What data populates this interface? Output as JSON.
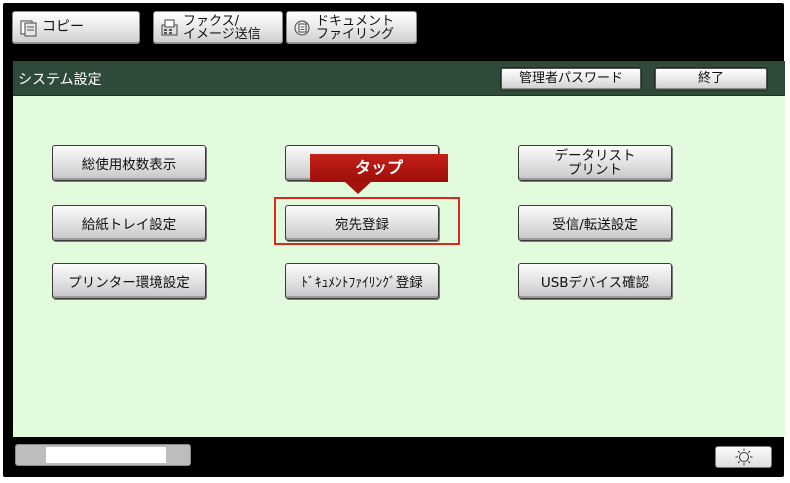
{
  "tabs": [
    {
      "label": "コピー",
      "icon": "copy-icon"
    },
    {
      "label": "ファクス/\nイメージ送信",
      "icon": "fax-icon"
    },
    {
      "label": "ドキュメント\nファイリング",
      "icon": "document-filing-icon"
    }
  ],
  "header": {
    "title": "システム設定",
    "admin_password": "管理者パスワード",
    "end": "終了"
  },
  "buttons": {
    "total_count": "総使用枚数表示",
    "paper_tray": "給紙トレイ設定",
    "printer_env": "プリンター環境設定",
    "blank": "",
    "address_book": "宛先登録",
    "doc_filing_reg": "ﾄﾞｷｭﾒﾝﾄﾌｧｲﾘﾝｸﾞ登録",
    "data_list": "データリスト\nプリント",
    "receive_forward": "受信/転送設定",
    "usb_check": "USBデバイス確認"
  },
  "annotation": {
    "tap_label": "タップ"
  },
  "icons": {
    "brightness": "brightness-icon"
  },
  "colors": {
    "panel_bg": "#e3fbdd",
    "titlebar_bg": "#2f4a39",
    "highlight": "#e1261c",
    "tap_bg": "#b5170f"
  }
}
